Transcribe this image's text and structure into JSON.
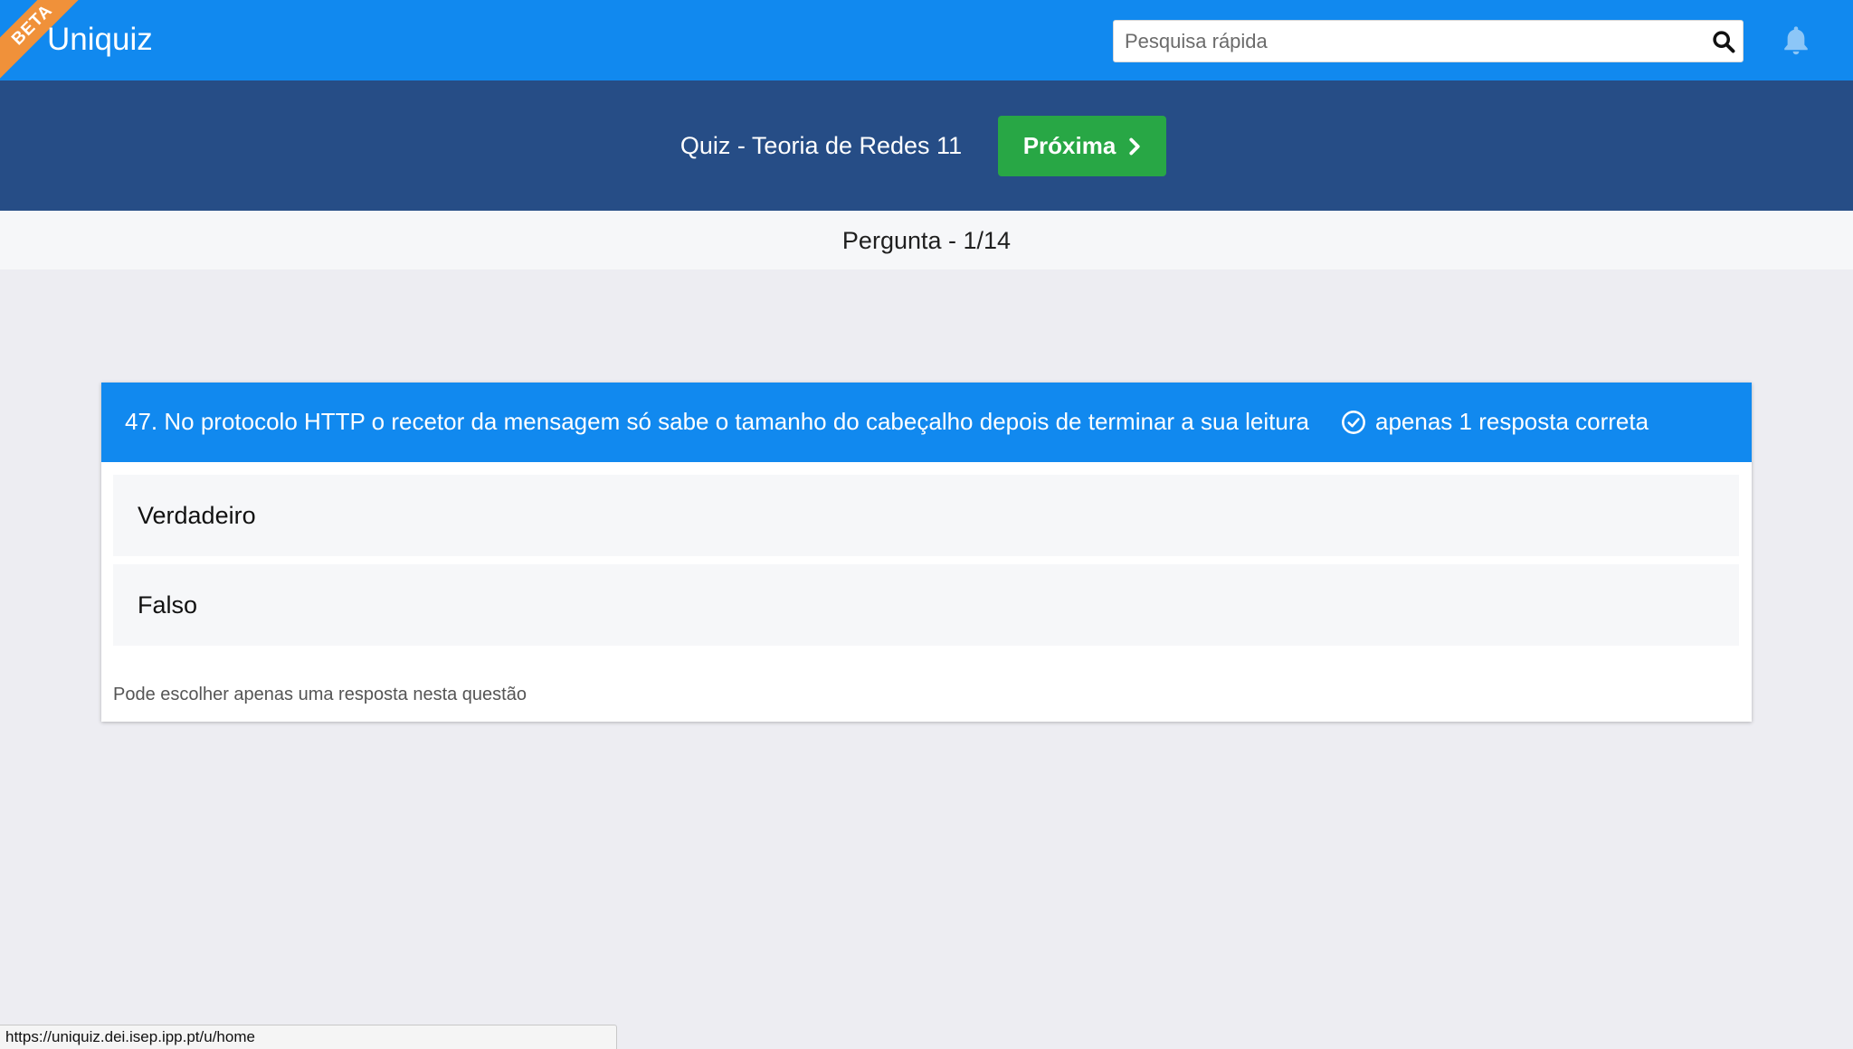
{
  "header": {
    "beta_label": "BETA",
    "brand": "Uniquiz",
    "search_placeholder": "Pesquisa rápida",
    "colors": {
      "bar": "#1189ef",
      "beta": "#f0913a"
    }
  },
  "quiz": {
    "title": "Quiz - Teoria de Redes 11",
    "next_label": "Próxima",
    "colors": {
      "bar": "#264d86",
      "next_button": "#28a745"
    }
  },
  "progress": {
    "label": "Pergunta - 1/14"
  },
  "question": {
    "text": "47. No protocolo HTTP o recetor da mensagem só sabe o tamanho do cabeçalho depois de terminar a sua leitura",
    "rule": "apenas 1 resposta correta",
    "options": [
      {
        "label": "Verdadeiro"
      },
      {
        "label": "Falso"
      }
    ],
    "hint": "Pode escolher apenas uma resposta nesta questão"
  },
  "status_bar": {
    "url": "https://uniquiz.dei.isep.ipp.pt/u/home"
  },
  "icons": [
    "search-icon",
    "bell-icon",
    "chevron-right-icon",
    "check-circle-icon"
  ]
}
